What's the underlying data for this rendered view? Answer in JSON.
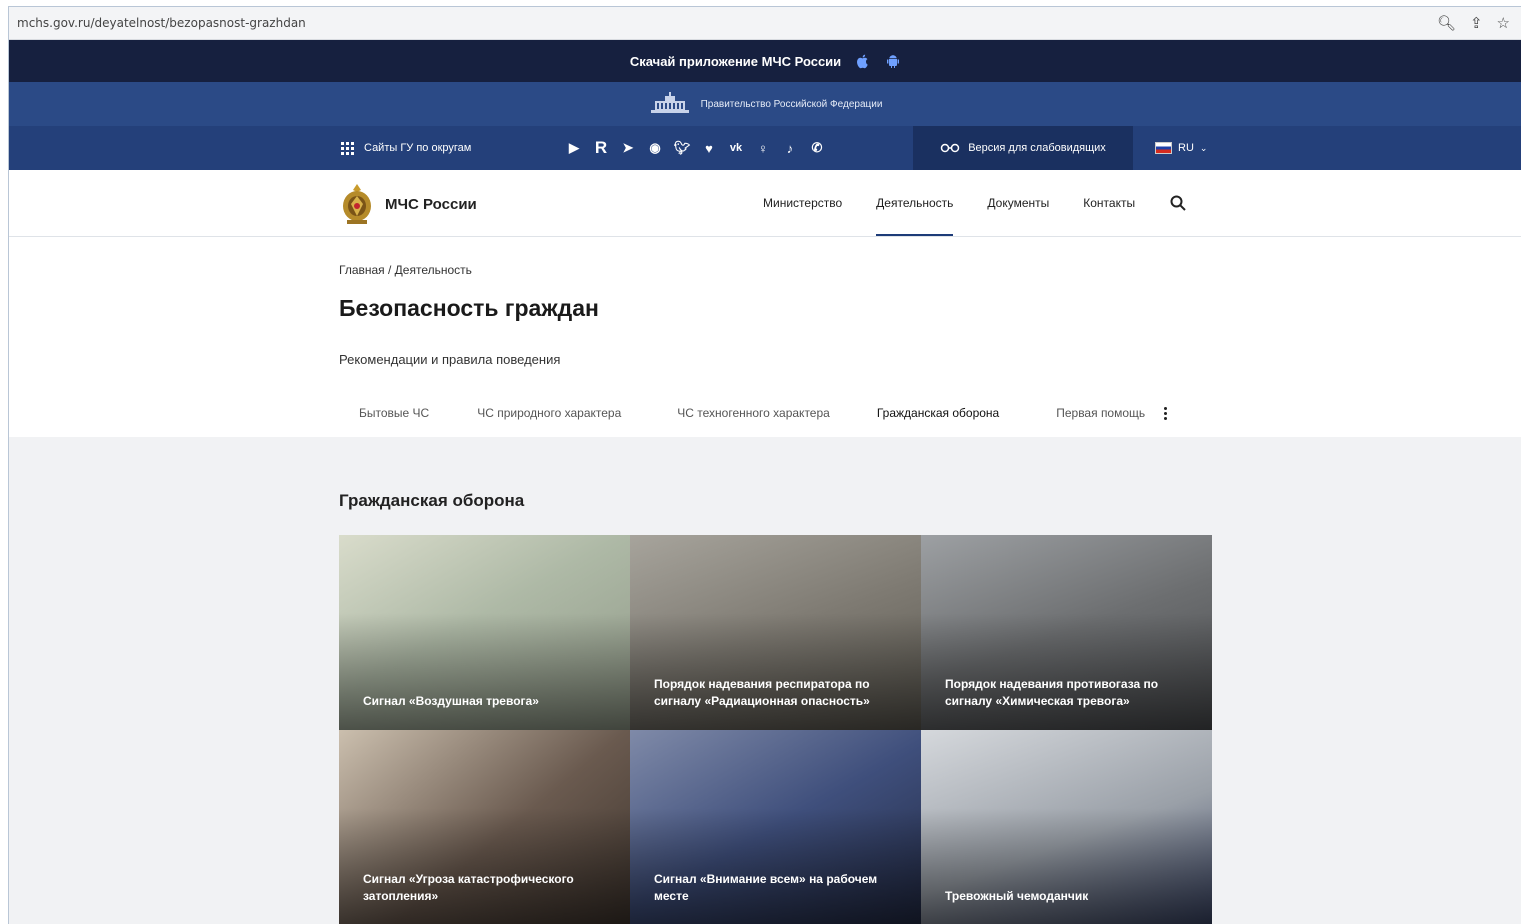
{
  "browser": {
    "url": "mchs.gov.ru/deyatelnost/bezopasnost-grazhdan"
  },
  "app_banner": {
    "text": "Скачай приложение МЧС России"
  },
  "gov_bar": {
    "text": "Правительство Российской Федерации"
  },
  "social_bar": {
    "districts_label": "Сайты ГУ по округам",
    "social_icons": [
      "youtube-icon",
      "rutube-icon",
      "telegram-icon",
      "odnoklassniki-circle-icon",
      "twitter-icon",
      "heart-icon",
      "vk-icon",
      "ok-icon",
      "tiktok-icon",
      "whatsapp-icon"
    ],
    "impaired_label": "Версия для слабовидящих",
    "lang_label": "RU"
  },
  "header": {
    "site_name": "МЧС России",
    "nav": [
      {
        "label": "Министерство"
      },
      {
        "label": "Деятельность"
      },
      {
        "label": "Документы"
      },
      {
        "label": "Контакты"
      }
    ]
  },
  "page": {
    "breadcrumb": "Главная / Деятельность",
    "title": "Безопасность граждан",
    "subtitle": "Рекомендации и правила поведения",
    "tabs": [
      {
        "label": "Бытовые ЧС"
      },
      {
        "label": "ЧС природного характера"
      },
      {
        "label": "ЧС техногенного характера"
      },
      {
        "label": "Гражданская оборона"
      },
      {
        "label": "Первая помощь"
      }
    ],
    "section_title": "Гражданская оборона",
    "cards": [
      {
        "caption": "Сигнал «Воздушная тревога»",
        "tone": "#aeb9a6"
      },
      {
        "caption": "Порядок надевания респиратора по сигналу «Радиационная опасность»",
        "tone": "#7e7a72"
      },
      {
        "caption": "Порядок надевания противогаза по сигналу «Химическая тревога»",
        "tone": "#6c6e70"
      },
      {
        "caption": "Сигнал «Угроза катастрофического затопления»",
        "tone": "#6a5a4f"
      },
      {
        "caption": "Сигнал «Внимание всем» на рабочем месте",
        "tone": "#3f4f7c"
      },
      {
        "caption": "Тревожный чемоданчик",
        "tone": "#9aa0a8"
      }
    ]
  },
  "colors": {
    "app_banner_bg": "#16203f",
    "gov_bar_bg": "#2b4a86",
    "social_bar_bg": "#24407a",
    "accent": "#1d3b78"
  }
}
